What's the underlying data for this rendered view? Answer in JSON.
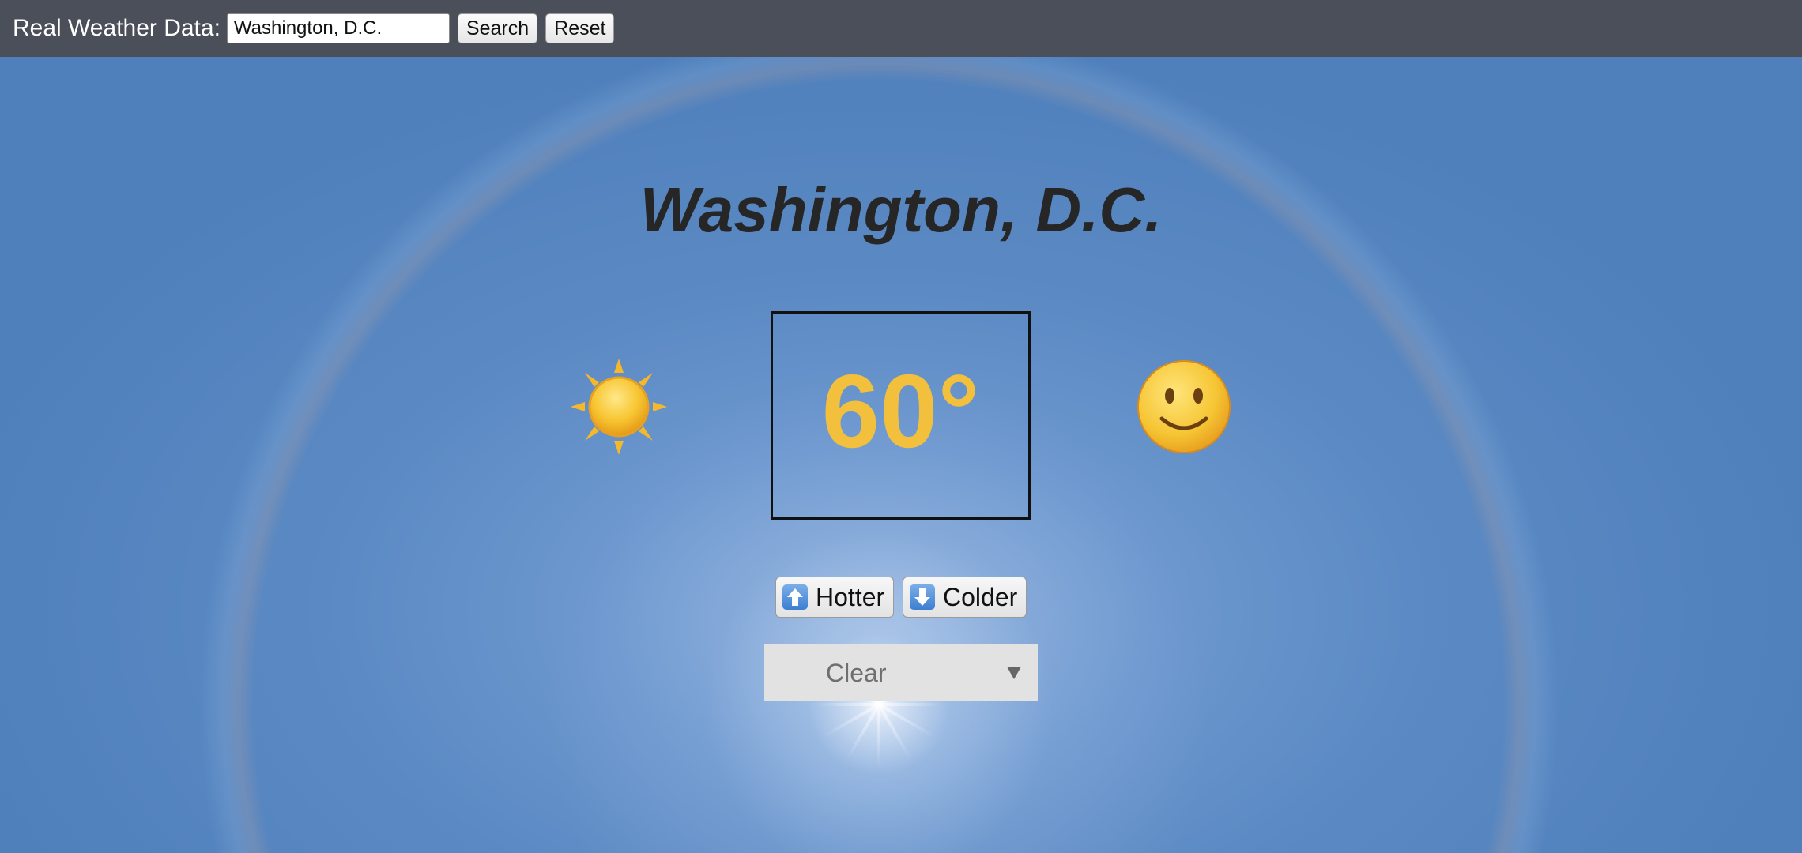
{
  "header": {
    "label": "Real Weather Data:",
    "search_value": "Washington, D.C.",
    "search_button": "Search",
    "reset_button": "Reset"
  },
  "main": {
    "city": "Washington, D.C.",
    "temperature": "60°",
    "condition_icon": "sun-icon",
    "mood_icon": "smiling-face-icon",
    "hotter_button": "Hotter",
    "colder_button": "Colder",
    "condition_select": {
      "selected": "Clear"
    }
  },
  "colors": {
    "header_bg": "#4b4f59",
    "temperature": "#f2c03c",
    "city_title": "#262626"
  }
}
